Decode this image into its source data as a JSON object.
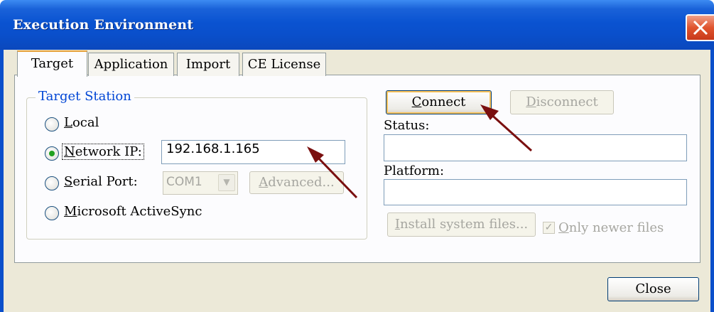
{
  "window": {
    "title": "Execution Environment"
  },
  "tabs": [
    {
      "label": "Target",
      "active": true
    },
    {
      "label": "Application",
      "active": false
    },
    {
      "label": "Import",
      "active": false
    },
    {
      "label": "CE License",
      "active": false
    }
  ],
  "target_station": {
    "group_label": "Target Station",
    "options": [
      {
        "key": "L",
        "rest": "ocal",
        "checked": false
      },
      {
        "key": "N",
        "rest": "etwork IP:",
        "checked": true
      },
      {
        "key": "S",
        "rest": "erial Port:",
        "checked": false
      },
      {
        "key": "M",
        "rest": "icrosoft ActiveSync",
        "checked": false
      }
    ],
    "network_ip_value": "192.168.1.165",
    "serial_port_value": "COM1",
    "advanced": {
      "key": "A",
      "rest": "dvanced..."
    }
  },
  "connection": {
    "connect": {
      "key": "C",
      "rest": "onnect"
    },
    "disconnect": {
      "key": "D",
      "rest": "isconnect"
    },
    "status_label": "Status:",
    "status_value": "",
    "platform_label": "Platform:",
    "platform_value": "",
    "install": {
      "key": "I",
      "rest": "nstall system files..."
    },
    "only_newer": {
      "key": "O",
      "rest": "nly newer files",
      "checked": true
    }
  },
  "footer": {
    "close_label": "Close"
  },
  "colors": {
    "titlebar": "#0a4fcb",
    "accent": "#0046d5",
    "arrow": "#7a0f0f",
    "close": "#e0542e"
  },
  "icons": {
    "close": "close-x-icon",
    "dropdown": "chevron-down-icon",
    "checkmark": "checkmark-icon",
    "arrow": "arrow-annotation-icon"
  }
}
